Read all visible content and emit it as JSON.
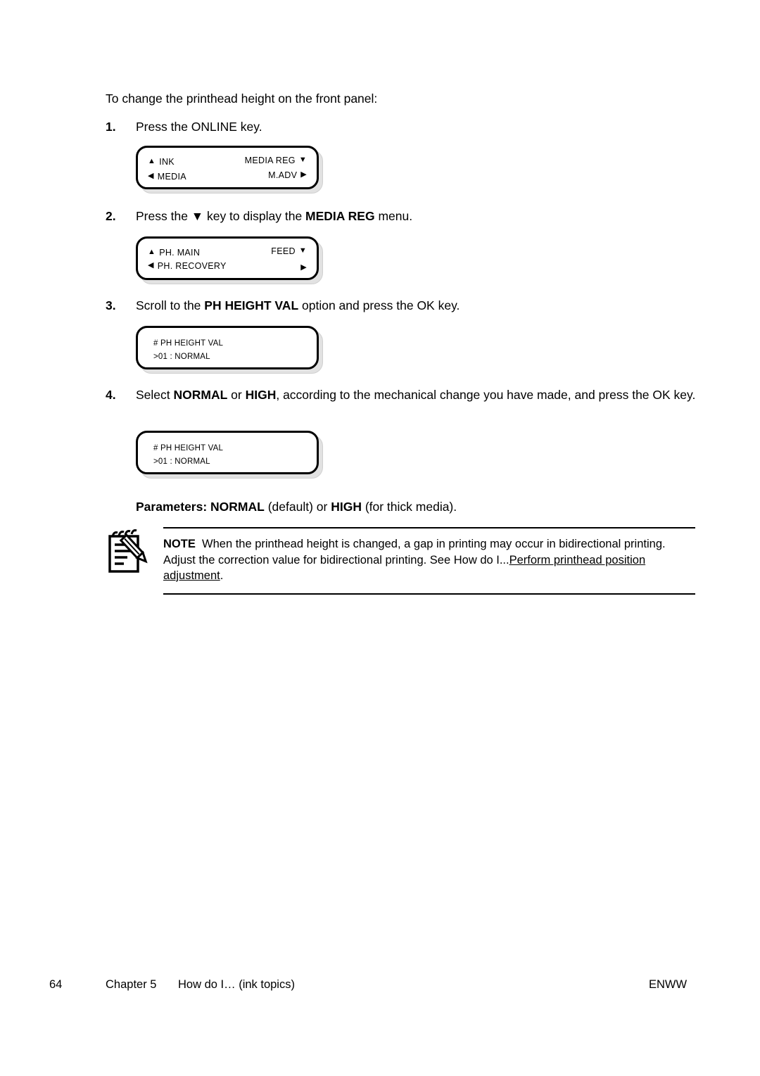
{
  "document": {
    "intro": "To change the printhead height on the front panel:",
    "steps": [
      {
        "number": "1.",
        "segments": [
          {
            "text": "Press the ONLINE key.",
            "bold": false
          }
        ]
      },
      {
        "number": "2.",
        "segments": [
          {
            "text": "Press the ▼ key to display the ",
            "bold": false
          },
          {
            "text": "MEDIA REG",
            "bold": true
          },
          {
            "text": " menu.",
            "bold": false
          }
        ]
      },
      {
        "number": "3.",
        "segments": [
          {
            "text": "Scroll to the ",
            "bold": false
          },
          {
            "text": "PH HEIGHT VAL",
            "bold": true
          },
          {
            "text": " option and press the OK key.",
            "bold": false
          }
        ]
      },
      {
        "number": "4.",
        "segments": [
          {
            "text": "Select ",
            "bold": false
          },
          {
            "text": "NORMAL",
            "bold": true
          },
          {
            "text": " or ",
            "bold": false
          },
          {
            "text": "HIGH",
            "bold": true
          },
          {
            "text": ", according to the mechanical change you have made, and press the OK key.",
            "bold": false
          }
        ]
      }
    ],
    "panels": [
      {
        "id": "panel-online-menu",
        "style": "menu",
        "rows": [
          {
            "left_arrow": "▲",
            "left_label": "INK",
            "right_label": "MEDIA REG",
            "right_arrow": "▼"
          },
          {
            "left_arrow": "◀",
            "left_label": "MEDIA",
            "right_label": "M.ADV",
            "right_arrow": "▶"
          }
        ]
      },
      {
        "id": "panel-media-reg-menu",
        "style": "menu",
        "rows": [
          {
            "left_arrow": "▲",
            "left_label": "PH. MAIN",
            "right_label": "FEED",
            "right_arrow": "▼"
          },
          {
            "left_arrow": "◀",
            "left_label": "PH. RECOVERY",
            "right_label": "",
            "right_arrow": "▶"
          }
        ]
      },
      {
        "id": "panel-ph-height-val-1",
        "style": "value",
        "lines": [
          "# PH HEIGHT VAL",
          ">01 : NORMAL"
        ]
      },
      {
        "id": "panel-ph-height-val-2",
        "style": "value",
        "lines": [
          "# PH HEIGHT VAL",
          ">01 : NORMAL"
        ]
      }
    ],
    "parameters": {
      "label": "Parameters:",
      "value_1": "NORMAL",
      "suffix_1": " (default) or ",
      "value_2": "HIGH",
      "suffix_2": " (for thick media)."
    },
    "note": {
      "icon": "note-pencil-icon",
      "label": "NOTE",
      "text_1": "When the printhead height is changed, a gap in printing may occur in bidirectional printing. Adjust the correction value for bidirectional printing. See How do I...",
      "link": "Perform printhead position adjustment",
      "text_2": "."
    },
    "footer": {
      "page_number": "64",
      "chapter": "Chapter 5",
      "section": "How do I… (ink topics)",
      "brand": "ENWW"
    }
  }
}
